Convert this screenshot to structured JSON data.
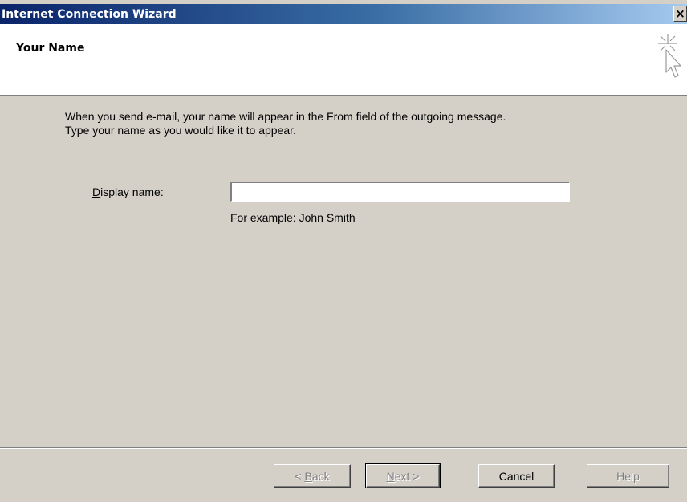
{
  "window": {
    "title": "Internet Connection Wizard",
    "close_glyph": "×"
  },
  "header": {
    "title": "Your Name",
    "icon": "wizard-sparkle-cursor-icon"
  },
  "body": {
    "intro_line1": "When you send e-mail, your name will appear in the From field of the outgoing message.",
    "intro_line2": "Type your name as you would like it to appear."
  },
  "form": {
    "display_name_label_key": "D",
    "display_name_label_rest": "isplay name:",
    "display_name_value": "",
    "example": "For example: John Smith"
  },
  "buttons": {
    "back_prefix": "< ",
    "back_key": "B",
    "back_rest": "ack",
    "next_key": "N",
    "next_rest": "ext >",
    "cancel": "Cancel",
    "help": "Help"
  },
  "colors": {
    "dialog_face": "#d4d0c8",
    "titlebar_start": "#0a246a",
    "titlebar_end": "#a6caf0",
    "disabled_text": "#808080"
  }
}
